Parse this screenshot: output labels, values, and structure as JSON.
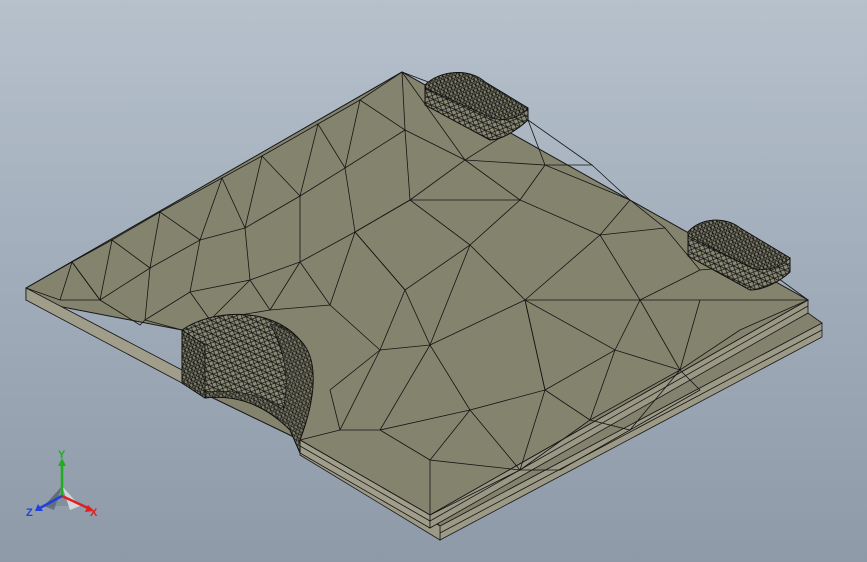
{
  "viewport": {
    "background_top": "#b6c1cc",
    "background_bottom": "#8e9aa8",
    "mesh_face_color": "#84836e",
    "mesh_side_color": "#9a9885",
    "mesh_edge_color": "#141414"
  },
  "triad": {
    "x_label": "X",
    "y_label": "Y",
    "z_label": "Z",
    "x_color": "#e02020",
    "y_color": "#1fae1f",
    "z_color": "#2040d8"
  }
}
